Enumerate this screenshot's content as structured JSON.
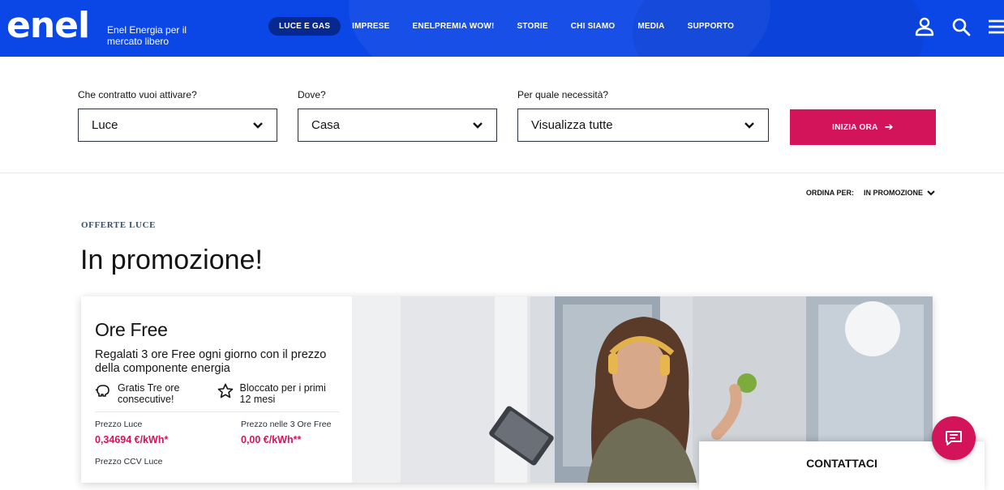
{
  "header": {
    "logo": "enel",
    "tagline": "Enel Energia per il mercato libero",
    "nav": [
      {
        "label": "LUCE E GAS",
        "active": true
      },
      {
        "label": "IMPRESE"
      },
      {
        "label": "ENELPREMIA WOW!"
      },
      {
        "label": "STORIE"
      },
      {
        "label": "CHI SIAMO"
      },
      {
        "label": "MEDIA"
      },
      {
        "label": "SUPPORTO"
      }
    ],
    "icons": [
      "user-icon",
      "search-icon",
      "menu-icon"
    ],
    "color": "#0b46e6"
  },
  "filters": {
    "contract": {
      "label": "Che contratto vuoi attivare?",
      "value": "Luce"
    },
    "where": {
      "label": "Dove?",
      "value": "Casa"
    },
    "need": {
      "label": "Per quale necessità?",
      "value": "Visualizza tutte"
    },
    "cta": "INIZIA ORA",
    "cta_color": "#d3135a"
  },
  "sort": {
    "label": "ORDINA PER:",
    "value": "IN PROMOZIONE"
  },
  "section": {
    "eyebrow": "OFFERTE LUCE",
    "title": "In promozione!"
  },
  "offer": {
    "title": "Ore Free",
    "description": "Regalati 3 ore Free ogni giorno con il prezzo della componente energia",
    "features": [
      {
        "icon": "piggy-bank-icon",
        "text": "Gratis Tre ore consecutive!"
      },
      {
        "icon": "star-icon",
        "text": "Bloccato per i primi 12 mesi"
      }
    ],
    "prices": [
      {
        "label": "Prezzo Luce",
        "value": "0,34694 €/kWh*"
      },
      {
        "label": "Prezzo nelle 3 Ore Free",
        "value": "0,00 €/kWh**"
      }
    ],
    "ccv_label": "Prezzo CCV Luce"
  },
  "contact": {
    "label": "CONTATTACI"
  }
}
